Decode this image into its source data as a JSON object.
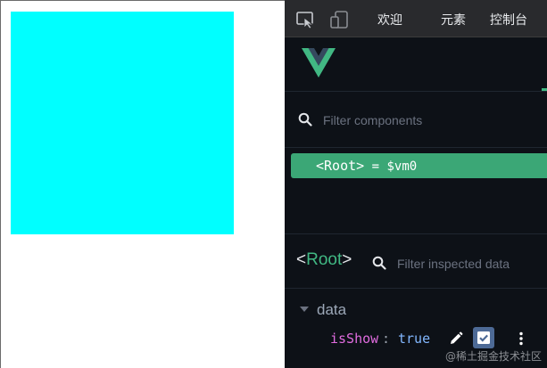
{
  "page": {
    "box_color": "#00ffff"
  },
  "devtools": {
    "toolbar": {
      "tabs": [
        "欢迎",
        "元素",
        "控制台"
      ],
      "icons": [
        "inspect-element-icon",
        "device-toolbar-icon"
      ]
    },
    "vue": {
      "logo": "vue-logo",
      "brand_colors": {
        "green": "#41b883",
        "dark": "#35495e"
      }
    },
    "components": {
      "filter_placeholder": "Filter components",
      "tree": [
        {
          "open": "<",
          "name": "Root",
          "close": ">",
          "suffix": " = $vm0",
          "selected": true
        }
      ]
    },
    "inspector": {
      "open": "<",
      "name": "Root",
      "close": ">",
      "filter_placeholder": "Filter inspected data",
      "section": "data",
      "props": [
        {
          "key": "isShow",
          "colon": ":",
          "value": "true",
          "type": "boolean"
        }
      ]
    }
  },
  "watermark": "@稀土掘金技术社区"
}
